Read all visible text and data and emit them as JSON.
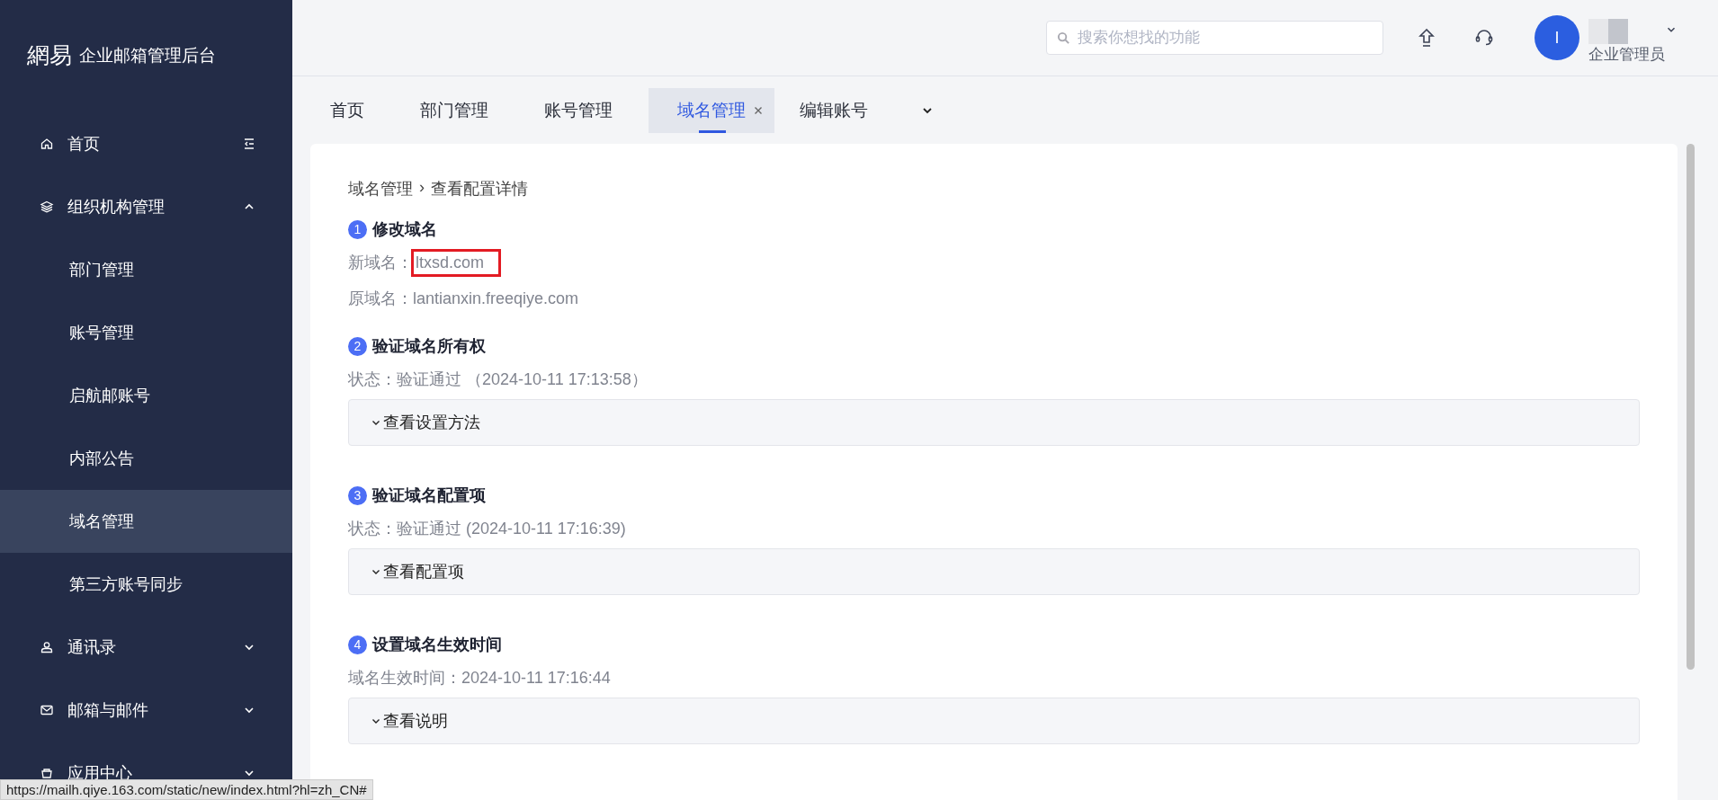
{
  "sidebar": {
    "logo": "網易",
    "title": "企业邮箱管理后台",
    "items": [
      {
        "label": "首页",
        "selected": false,
        "collapse_toggle": true
      },
      {
        "label": "组织机构管理",
        "selected": false,
        "expanded": true,
        "children": [
          {
            "label": "部门管理",
            "selected": false
          },
          {
            "label": "账号管理",
            "selected": false
          },
          {
            "label": "启航邮账号",
            "selected": false
          },
          {
            "label": "内部公告",
            "selected": false
          },
          {
            "label": "域名管理",
            "selected": true
          },
          {
            "label": "第三方账号同步",
            "selected": false
          }
        ]
      },
      {
        "label": "通讯录",
        "selected": false,
        "expanded": false
      },
      {
        "label": "邮箱与邮件",
        "selected": false,
        "expanded": false
      },
      {
        "label": "应用中心",
        "selected": false,
        "expanded": false
      }
    ]
  },
  "header": {
    "search": {
      "placeholder": "搜索你想找的功能"
    },
    "avatar_letter": "I",
    "role": "企业管理员"
  },
  "tabs": [
    {
      "label": "首页",
      "selected": false,
      "closable": false
    },
    {
      "label": "部门管理",
      "selected": false,
      "closable": false
    },
    {
      "label": "账号管理",
      "selected": false,
      "closable": false
    },
    {
      "label": "域名管理",
      "selected": true,
      "closable": true
    },
    {
      "label": "编辑账号",
      "selected": false,
      "closable": false
    }
  ],
  "breadcrumb": {
    "items": [
      "域名管理",
      "查看配置详情"
    ],
    "separator": "›"
  },
  "steps": [
    {
      "number": "1",
      "title": "修改域名",
      "lines": [
        {
          "label": "新域名：",
          "value": "ltxsd.com",
          "highlighted": true
        },
        {
          "label": "原域名：",
          "value": "lantianxin.freeqiye.com",
          "highlighted": false
        }
      ]
    },
    {
      "number": "2",
      "title": "验证域名所有权",
      "lines": [
        {
          "label": "状态：",
          "value": "验证通过 （2024-10-11 17:13:58）",
          "highlighted": false
        }
      ],
      "panel": {
        "label": "查看设置方法",
        "expanded": false
      }
    },
    {
      "number": "3",
      "title": "验证域名配置项",
      "lines": [
        {
          "label": "状态：",
          "value": "验证通过 (2024-10-11 17:16:39)",
          "highlighted": false
        }
      ],
      "panel": {
        "label": "查看配置项",
        "expanded": false
      }
    },
    {
      "number": "4",
      "title": "设置域名生效时间",
      "lines": [
        {
          "label": "域名生效时间：",
          "value": "2024-10-11 17:16:44",
          "highlighted": false
        }
      ],
      "panel": {
        "label": "查看说明",
        "expanded": false
      }
    }
  ],
  "status_url": "https://mailh.qiye.163.com/static/new/index.html?hl=zh_CN#"
}
